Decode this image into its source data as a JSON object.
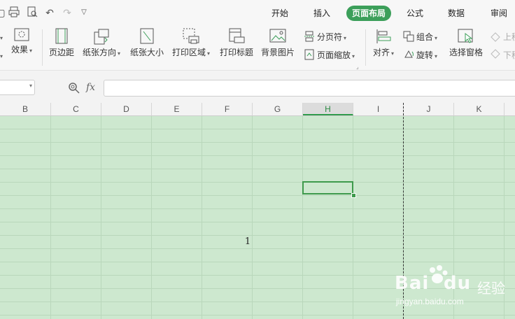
{
  "tabs": [
    "开始",
    "插入",
    "页面布局",
    "公式",
    "数据",
    "审阅"
  ],
  "active_tab": "页面布局",
  "ribbon": {
    "effects": "效果",
    "margins": "页边距",
    "orientation": "纸张方向",
    "size": "纸张大小",
    "print_area": "打印区域",
    "print_titles": "打印标题",
    "background": "背景图片",
    "page_break": "分页符",
    "page_scale": "页面缩放",
    "align": "对齐",
    "group": "组合",
    "rotate": "旋转",
    "selection_pane": "选择窗格",
    "bring_forward": "上移",
    "send_backward": "下移"
  },
  "formula_bar": {
    "fx": "fx",
    "value": ""
  },
  "columns": [
    "B",
    "C",
    "D",
    "E",
    "F",
    "G",
    "H",
    "I",
    "J",
    "K"
  ],
  "selected_column": "H",
  "cell_value": "1",
  "watermark": {
    "brand": "Bai",
    "brand2": "经验",
    "url": "jingyan.baidu.com"
  },
  "colors": {
    "accent": "#3c9f5a",
    "sheet_bg": "#cde8cf",
    "selection": "#3e9a4c"
  }
}
